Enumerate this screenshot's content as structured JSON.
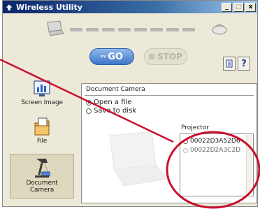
{
  "window": {
    "title": "Wireless Utility",
    "controls": {
      "minimize": "_",
      "maximize": "□",
      "close": "x"
    }
  },
  "toolbar": {
    "go_label": "GO",
    "go_antenna": "ᵖᵞ",
    "stop_label": "STOP",
    "help_label": "?"
  },
  "sidebar": {
    "items": [
      {
        "label": "Screen Image",
        "icon": "chart-screen-icon"
      },
      {
        "label": "File",
        "icon": "folder-icon"
      },
      {
        "label": "Document Camera",
        "label_line1": "Document",
        "label_line2": "Camera",
        "icon": "document-camera-icon",
        "active": true
      }
    ]
  },
  "panel": {
    "title": "Document Camera",
    "options": [
      {
        "label": "Open a file",
        "selected": true
      },
      {
        "label": "Save to disk",
        "selected": false
      }
    ],
    "projector_label": "Projector",
    "projectors": [
      "00022D3A52D6",
      "00022D2A3C2D"
    ]
  },
  "colors": {
    "annotation": "#c8102e",
    "go_button": "#3e76c8",
    "title_bar": "#0a246a"
  }
}
